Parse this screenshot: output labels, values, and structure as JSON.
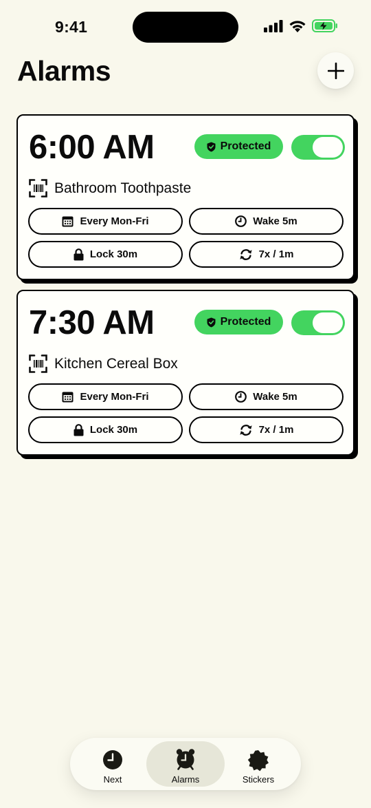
{
  "status_bar": {
    "time": "9:41"
  },
  "header": {
    "title": "Alarms",
    "add_icon": "plus-icon"
  },
  "colors": {
    "background": "#f9f8ec",
    "accent_green": "#43d45f",
    "card": "#fffffb",
    "ink": "#000000"
  },
  "alarms": [
    {
      "time": "6:00 AM",
      "badge": "Protected",
      "enabled": true,
      "target": "Bathroom Toothpaste",
      "schedule": "Every Mon-Fri",
      "wake": "Wake 5m",
      "lock": "Lock 30m",
      "repeat": "7x / 1m"
    },
    {
      "time": "7:30 AM",
      "badge": "Protected",
      "enabled": true,
      "target": "Kitchen Cereal Box",
      "schedule": "Every Mon-Fri",
      "wake": "Wake 5m",
      "lock": "Lock 30m",
      "repeat": "7x / 1m"
    }
  ],
  "tabs": [
    {
      "label": "Next",
      "icon": "clock-icon"
    },
    {
      "label": "Alarms",
      "icon": "alarm-clock-icon",
      "selected": true
    },
    {
      "label": "Stickers",
      "icon": "sticker-icon"
    }
  ]
}
